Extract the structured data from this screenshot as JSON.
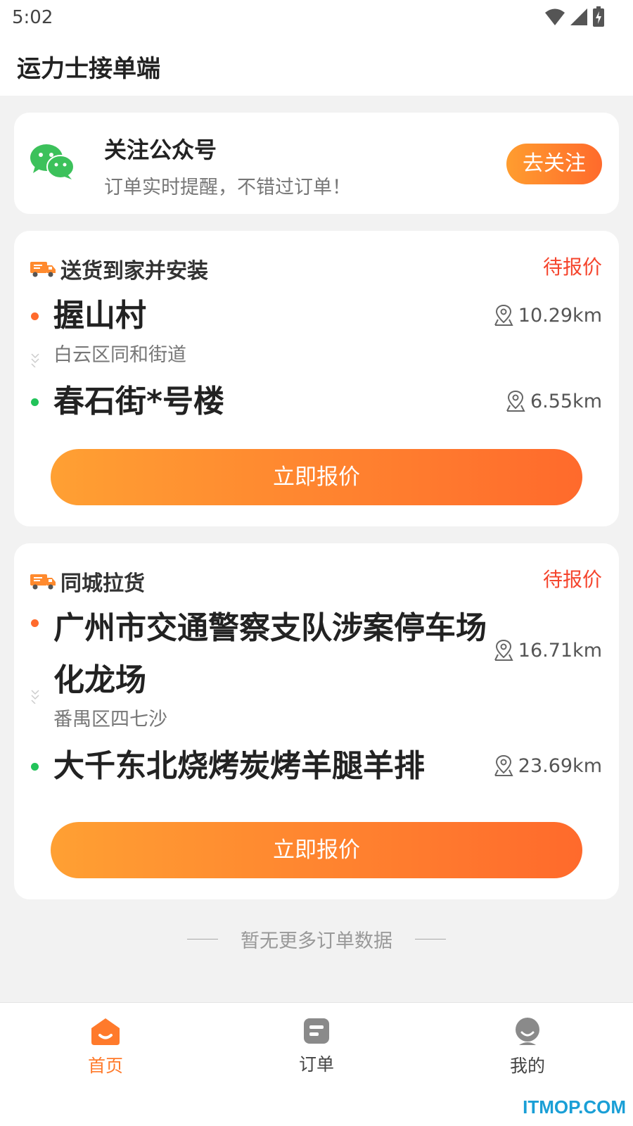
{
  "status_bar": {
    "time": "5:02"
  },
  "header": {
    "title": "运力士接单端"
  },
  "follow_card": {
    "icon": "wechat-icon",
    "title": "关注公众号",
    "subtitle": "订单实时提醒，不错过订单！",
    "button_label": "去关注"
  },
  "orders": [
    {
      "type": "送货到家并安装",
      "status": "待报价",
      "from": {
        "name": "握山村",
        "district": "白云区同和街道",
        "distance": "10.29km"
      },
      "to": {
        "name": "春石街*号楼",
        "distance": "6.55km"
      },
      "button_label": "立即报价"
    },
    {
      "type": "同城拉货",
      "status": "待报价",
      "from": {
        "name_line1": "广州市交通警察支队涉案停车场",
        "name_line2": "化龙场",
        "district": "番禺区四七沙",
        "distance": "16.71km"
      },
      "to": {
        "name": "大千东北烧烤炭烤羊腿羊排",
        "distance": "23.69km"
      },
      "button_label": "立即报价"
    }
  ],
  "footer_note": "暂无更多订单数据",
  "tabbar": {
    "items": [
      {
        "label": "首页",
        "active": true
      },
      {
        "label": "订单",
        "active": false
      },
      {
        "label": "我的",
        "active": false
      }
    ]
  },
  "watermark": "ITMOP.COM",
  "colors": {
    "accent": "#ff7a2b",
    "status_red": "#f5452d",
    "green": "#22c35a"
  }
}
